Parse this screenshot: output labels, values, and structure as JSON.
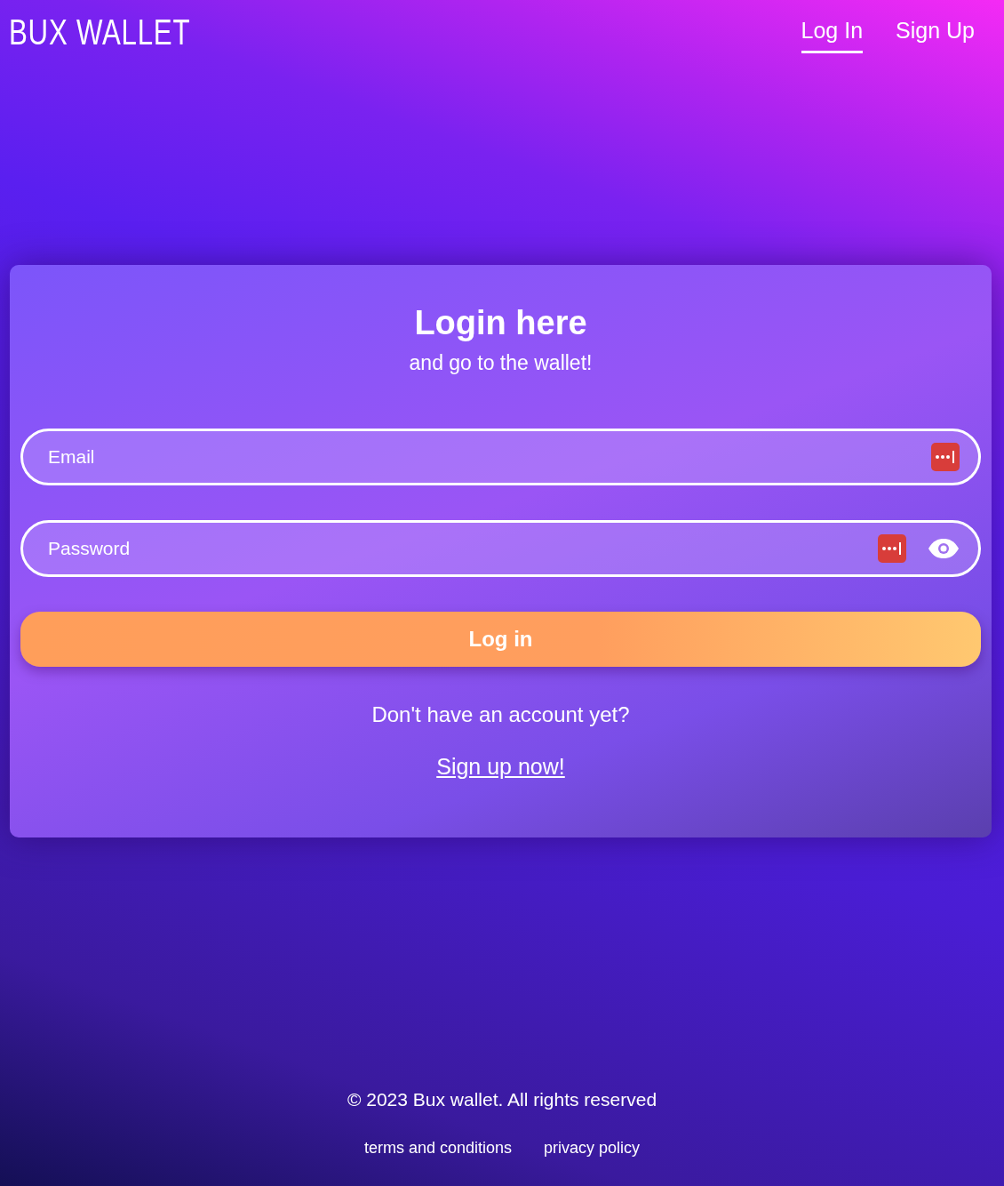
{
  "header": {
    "logo": "BUX WALLET",
    "nav": [
      {
        "label": "Log In",
        "selected": true
      },
      {
        "label": "Sign Up",
        "selected": false
      }
    ]
  },
  "login": {
    "title": "Login here",
    "subtitle": "and go to the wallet!",
    "fields": [
      {
        "kind": "email",
        "placeholder": "Email"
      },
      {
        "kind": "password",
        "placeholder": "Password"
      }
    ],
    "submit": "Log in",
    "prompt": "Don't have an account yet?",
    "signup_link": "Sign up now!"
  },
  "footer": {
    "copyright": "© 2023 Bux wallet. All rights reserved",
    "links": [
      "terms and conditions",
      "privacy policy"
    ]
  }
}
